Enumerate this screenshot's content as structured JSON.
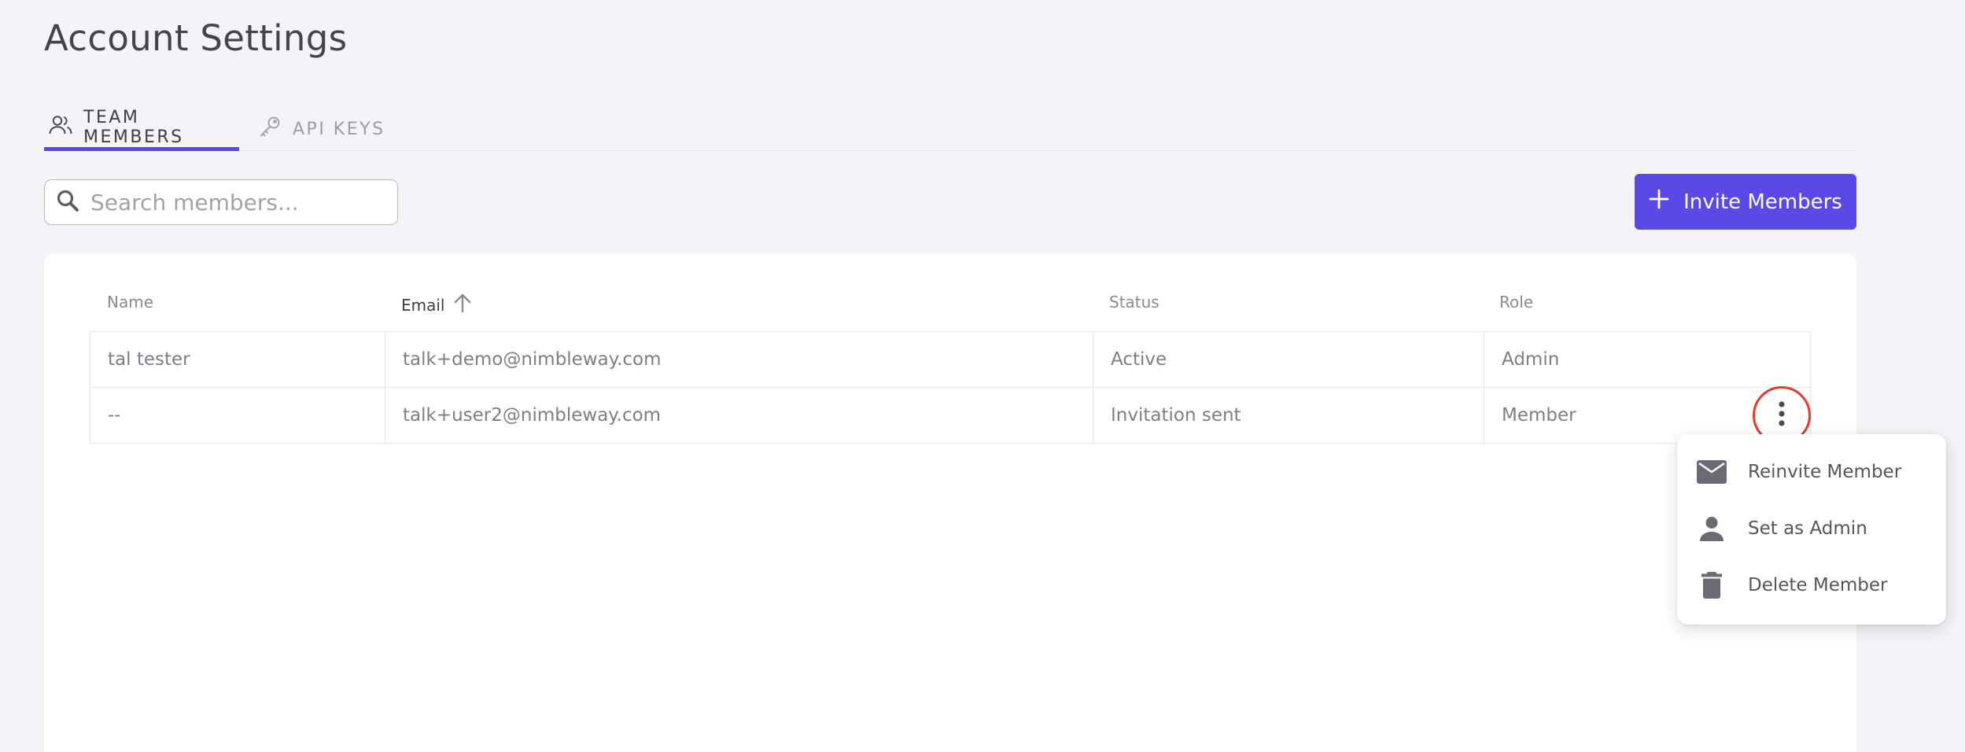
{
  "page": {
    "title": "Account Settings"
  },
  "tabs": [
    {
      "label": "TEAM MEMBERS",
      "icon": "people-icon",
      "active": true
    },
    {
      "label": "API KEYS",
      "icon": "key-icon",
      "active": false
    }
  ],
  "search": {
    "placeholder": "Search members...",
    "value": ""
  },
  "invite_button": {
    "label": "Invite Members",
    "icon": "plus-icon"
  },
  "table": {
    "columns": [
      "Name",
      "Email",
      "Status",
      "Role"
    ],
    "sorted_column": "Email",
    "sort_direction": "ascending",
    "rows": [
      {
        "name": "tal tester",
        "email": "talk+demo@nimbleway.com",
        "status": "Active",
        "role": "Admin"
      },
      {
        "name": "--",
        "email": "talk+user2@nimbleway.com",
        "status": "Invitation sent",
        "role": "Member"
      }
    ]
  },
  "row_menu": {
    "items": [
      {
        "label": "Reinvite Member",
        "icon": "envelope-icon"
      },
      {
        "label": "Set as Admin",
        "icon": "person-icon"
      },
      {
        "label": "Delete Member",
        "icon": "trash-icon"
      }
    ]
  },
  "colors": {
    "accent": "#5a49e6",
    "highlight_ring": "#e23a2e",
    "background": "#f4f4f8"
  }
}
